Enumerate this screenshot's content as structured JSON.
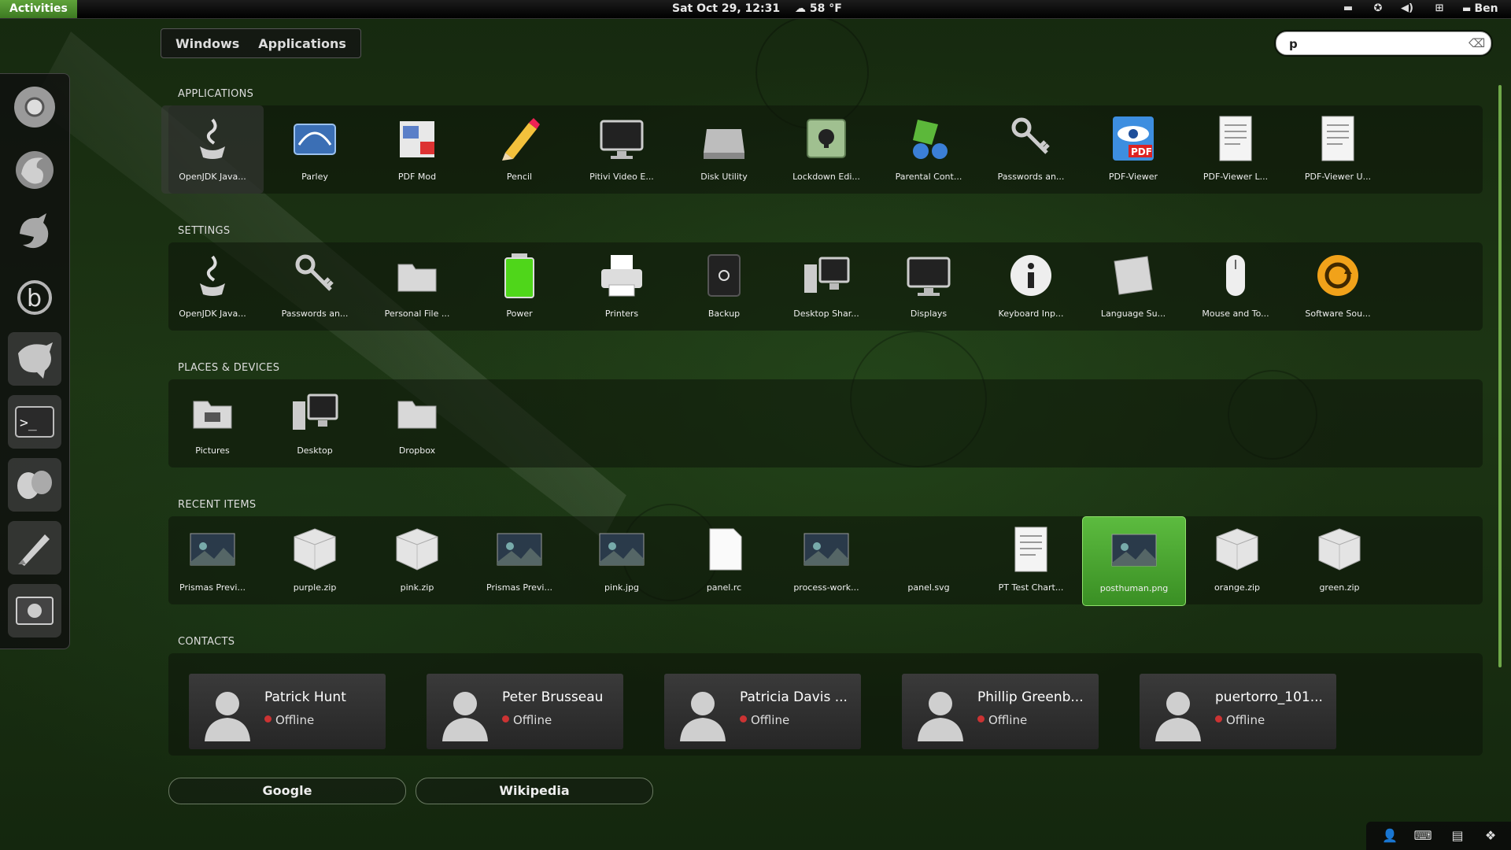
{
  "topbar": {
    "activities": "Activities",
    "clock": "Sat Oct 29, 12:31",
    "weather": "☁ 58 °F",
    "user": "Ben",
    "tray_icons": [
      "folder-icon",
      "accessibility-icon",
      "volume-icon",
      "network-icon"
    ]
  },
  "view_switch": {
    "windows": "Windows",
    "applications": "Applications"
  },
  "search": {
    "value": "p",
    "placeholder": ""
  },
  "dash": {
    "items": [
      "chromium-icon",
      "firefox-icon",
      "thunderbird-icon",
      "banshee-icon",
      "gimp-icon",
      "terminal-icon",
      "empathy-icon",
      "inkscape-icon",
      "gnome-screenshot-icon"
    ]
  },
  "sections": {
    "applications": "APPLICATIONS",
    "settings": "SETTINGS",
    "places": "PLACES & DEVICES",
    "recent": "RECENT ITEMS",
    "contacts": "CONTACTS"
  },
  "applications": [
    {
      "label": "OpenJDK Java...",
      "icon": "java-icon"
    },
    {
      "label": "Parley",
      "icon": "parley-icon"
    },
    {
      "label": "PDF Mod",
      "icon": "pdf-mod-icon"
    },
    {
      "label": "Pencil",
      "icon": "pencil-icon"
    },
    {
      "label": "Pitivi Video E...",
      "icon": "monitor-icon"
    },
    {
      "label": "Disk Utility",
      "icon": "disk-icon"
    },
    {
      "label": "Lockdown Edi...",
      "icon": "lock-icon"
    },
    {
      "label": "Parental Cont...",
      "icon": "parental-icon"
    },
    {
      "label": "Passwords an...",
      "icon": "keys-icon"
    },
    {
      "label": "PDF-Viewer",
      "icon": "pdf-viewer-icon"
    },
    {
      "label": "PDF-Viewer L...",
      "icon": "document-icon"
    },
    {
      "label": "PDF-Viewer U...",
      "icon": "document-icon"
    }
  ],
  "settings": [
    {
      "label": "OpenJDK Java...",
      "icon": "java-icon"
    },
    {
      "label": "Passwords an...",
      "icon": "keys-icon"
    },
    {
      "label": "Personal File ...",
      "icon": "folder-icon"
    },
    {
      "label": "Power",
      "icon": "battery-icon"
    },
    {
      "label": "Printers",
      "icon": "printer-icon"
    },
    {
      "label": "Backup",
      "icon": "backup-icon"
    },
    {
      "label": "Desktop Shar...",
      "icon": "desktop-share-icon"
    },
    {
      "label": "Displays",
      "icon": "monitor-icon"
    },
    {
      "label": "Keyboard Inp...",
      "icon": "info-icon"
    },
    {
      "label": "Language Su...",
      "icon": "language-icon"
    },
    {
      "label": "Mouse and To...",
      "icon": "mouse-icon"
    },
    {
      "label": "Software Sou...",
      "icon": "software-update-icon"
    }
  ],
  "places": [
    {
      "label": "Pictures",
      "icon": "pictures-folder-icon"
    },
    {
      "label": "Desktop",
      "icon": "desktop-icon"
    },
    {
      "label": "Dropbox",
      "icon": "folder-icon"
    }
  ],
  "recent": [
    {
      "label": "Prismas Previ...",
      "icon": "image-thumb-icon"
    },
    {
      "label": "purple.zip",
      "icon": "zip-icon"
    },
    {
      "label": "pink.zip",
      "icon": "zip-icon"
    },
    {
      "label": "Prismas Previ...",
      "icon": "image-thumb-icon"
    },
    {
      "label": "pink.jpg",
      "icon": "image-thumb-icon"
    },
    {
      "label": "panel.rc",
      "icon": "text-file-icon"
    },
    {
      "label": "process-work...",
      "icon": "image-thumb-icon"
    },
    {
      "label": "panel.svg",
      "icon": "svg-file-icon"
    },
    {
      "label": "PT Test Chart...",
      "icon": "document-icon"
    },
    {
      "label": "posthuman.png",
      "icon": "image-thumb-icon"
    },
    {
      "label": "orange.zip",
      "icon": "zip-icon"
    },
    {
      "label": "green.zip",
      "icon": "zip-icon"
    }
  ],
  "contacts": [
    {
      "name": "Patrick Hunt",
      "status": "Offline"
    },
    {
      "name": "Peter Brusseau",
      "status": "Offline"
    },
    {
      "name": "Patricia Davis ...",
      "status": "Offline"
    },
    {
      "name": "Phillip Greenb...",
      "status": "Offline"
    },
    {
      "name": "puertorro_101...",
      "status": "Offline"
    }
  ],
  "providers": [
    "Google",
    "Wikipedia"
  ],
  "message_tray": [
    "user-icon",
    "keyboard-icon",
    "notes-icon",
    "dropbox-icon"
  ],
  "colors": {
    "accent": "#4b9a2c",
    "highlight": "#5cbb3f",
    "offline": "#cc3333"
  }
}
